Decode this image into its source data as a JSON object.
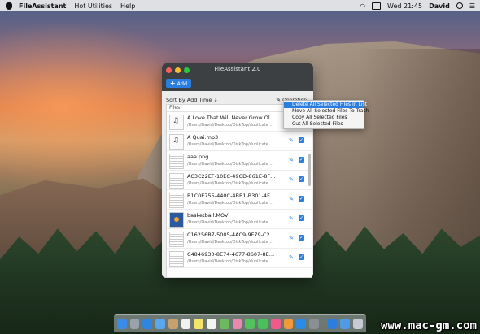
{
  "menubar": {
    "app_name": "FileAssistant",
    "menus": [
      "Hot Utilities",
      "Help"
    ],
    "clock": "Wed 21:45",
    "user": "David"
  },
  "window": {
    "title": "FileAssistant 2.0",
    "add_label": "Add",
    "sort_label": "Sort By Add Time ↓",
    "operation_label": "Operation",
    "list_header": "Files"
  },
  "files": [
    {
      "name": "A Love That Will Never Grow Old-e...",
      "path": "/Users/David/Desktop/DiskTop/duplicate fi...",
      "type": "music"
    },
    {
      "name": "A Quai.mp3",
      "path": "/Users/David/Desktop/DiskTop/duplicate fi...",
      "type": "music"
    },
    {
      "name": "aaa.png",
      "path": "/Users/David/Desktop/DiskTop/duplicate fi...",
      "type": "doc"
    },
    {
      "name": "AC3C22EF-10EC-49CD-861E-8F2F...",
      "path": "/Users/David/Desktop/DiskTop/duplicate fi...",
      "type": "doc"
    },
    {
      "name": "B1C0E755-440C-4BB1-B301-4FFF7...",
      "path": "/Users/David/Desktop/DiskTop/duplicate fi...",
      "type": "doc"
    },
    {
      "name": "basketball.MOV",
      "path": "/Users/David/Desktop/DiskTop/duplicate fi...",
      "type": "video"
    },
    {
      "name": "C16256B7-5005-4AC9-9F79-C287F...",
      "path": "/Users/David/Desktop/DiskTop/duplicate fi...",
      "type": "doc"
    },
    {
      "name": "C4846930-8E74-4677-8607-8E54B...",
      "path": "/Users/David/Desktop/DiskTop/duplicate fi...",
      "type": "doc"
    }
  ],
  "operation_menu": {
    "options": [
      "Delete All Selected Files In List",
      "Move All Selected Files To Trash",
      "Copy All Selected Files",
      "Cut All Selected Files"
    ],
    "selected_index": 0
  },
  "dock": {
    "items": [
      "finder-icon",
      "launchpad-icon",
      "safari-icon",
      "mail-icon",
      "contacts-icon",
      "calendar-icon",
      "notes-icon",
      "reminders-icon",
      "maps-icon",
      "photos-icon",
      "messages-icon",
      "facetime-icon",
      "itunes-icon",
      "ibooks-icon",
      "appstore-icon",
      "preferences-icon",
      "fileassistant-icon",
      "downloads-icon",
      "trash-icon"
    ],
    "colors": [
      "#3d8be8",
      "#9aa2ad",
      "#2f86e0",
      "#5aa7ee",
      "#c7a070",
      "#f2f2f2",
      "#f5e46a",
      "#f3f3f3",
      "#6cba5e",
      "#e88ab0",
      "#52c35b",
      "#4ac05a",
      "#f05a8a",
      "#f09a3a",
      "#2b8be6",
      "#8a8f96",
      "#2a7de1",
      "#4f9be8",
      "#c8ccd2"
    ]
  },
  "watermark": "www.mac-gm.com"
}
